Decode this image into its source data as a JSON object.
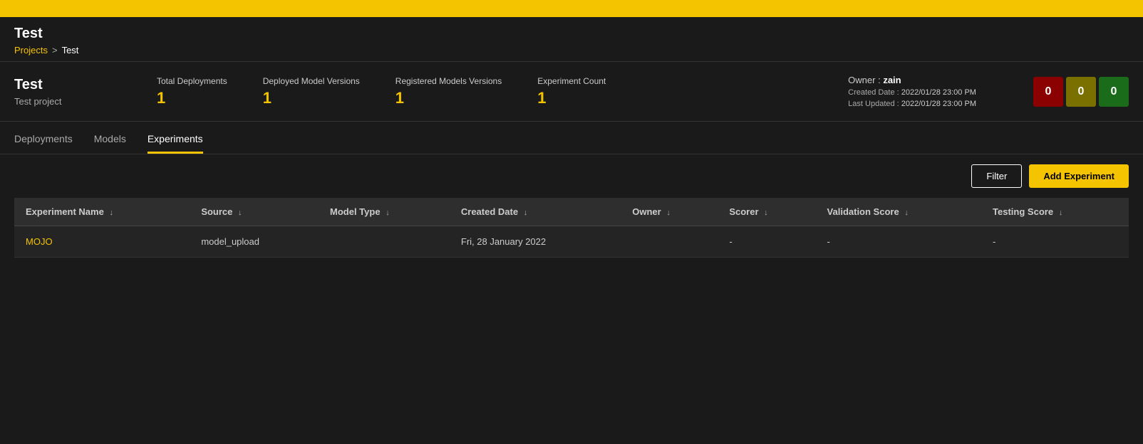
{
  "topbar": {},
  "header": {
    "page_title": "Test",
    "breadcrumb": {
      "projects_label": "Projects",
      "separator": ">",
      "current": "Test"
    }
  },
  "project_info": {
    "name": "Test",
    "description": "Test project",
    "stats": {
      "total_deployments_label": "Total Deployments",
      "total_deployments_value": "1",
      "deployed_model_versions_label": "Deployed Model Versions",
      "deployed_model_versions_value": "1",
      "registered_models_versions_label": "Registered Models Versions",
      "registered_models_versions_value": "1",
      "experiment_count_label": "Experiment Count",
      "experiment_count_value": "1"
    },
    "owner_label": "Owner :",
    "owner_name": "zain",
    "created_date_label": "Created Date :",
    "created_date_value": "2022/01/28 23:00 PM",
    "last_updated_label": "Last Updated :",
    "last_updated_value": "2022/01/28 23:00 PM",
    "badges": {
      "red_value": "0",
      "olive_value": "0",
      "green_value": "0"
    }
  },
  "tabs": [
    {
      "label": "Deployments",
      "active": false
    },
    {
      "label": "Models",
      "active": false
    },
    {
      "label": "Experiments",
      "active": true
    }
  ],
  "actions": {
    "filter_label": "Filter",
    "add_experiment_label": "Add Experiment"
  },
  "table": {
    "columns": [
      {
        "label": "Experiment Name",
        "sort": "↓"
      },
      {
        "label": "Source",
        "sort": "↓"
      },
      {
        "label": "Model Type",
        "sort": "↓"
      },
      {
        "label": "Created Date",
        "sort": "↓"
      },
      {
        "label": "Owner",
        "sort": "↓"
      },
      {
        "label": "Scorer",
        "sort": "↓"
      },
      {
        "label": "Validation Score",
        "sort": "↓"
      },
      {
        "label": "Testing Score",
        "sort": "↓"
      }
    ],
    "rows": [
      {
        "experiment_name": "MOJO",
        "source": "model_upload",
        "model_type": "",
        "created_date": "Fri, 28 January 2022",
        "owner": "",
        "scorer": "-",
        "validation_score": "-",
        "testing_score": "-"
      }
    ]
  }
}
